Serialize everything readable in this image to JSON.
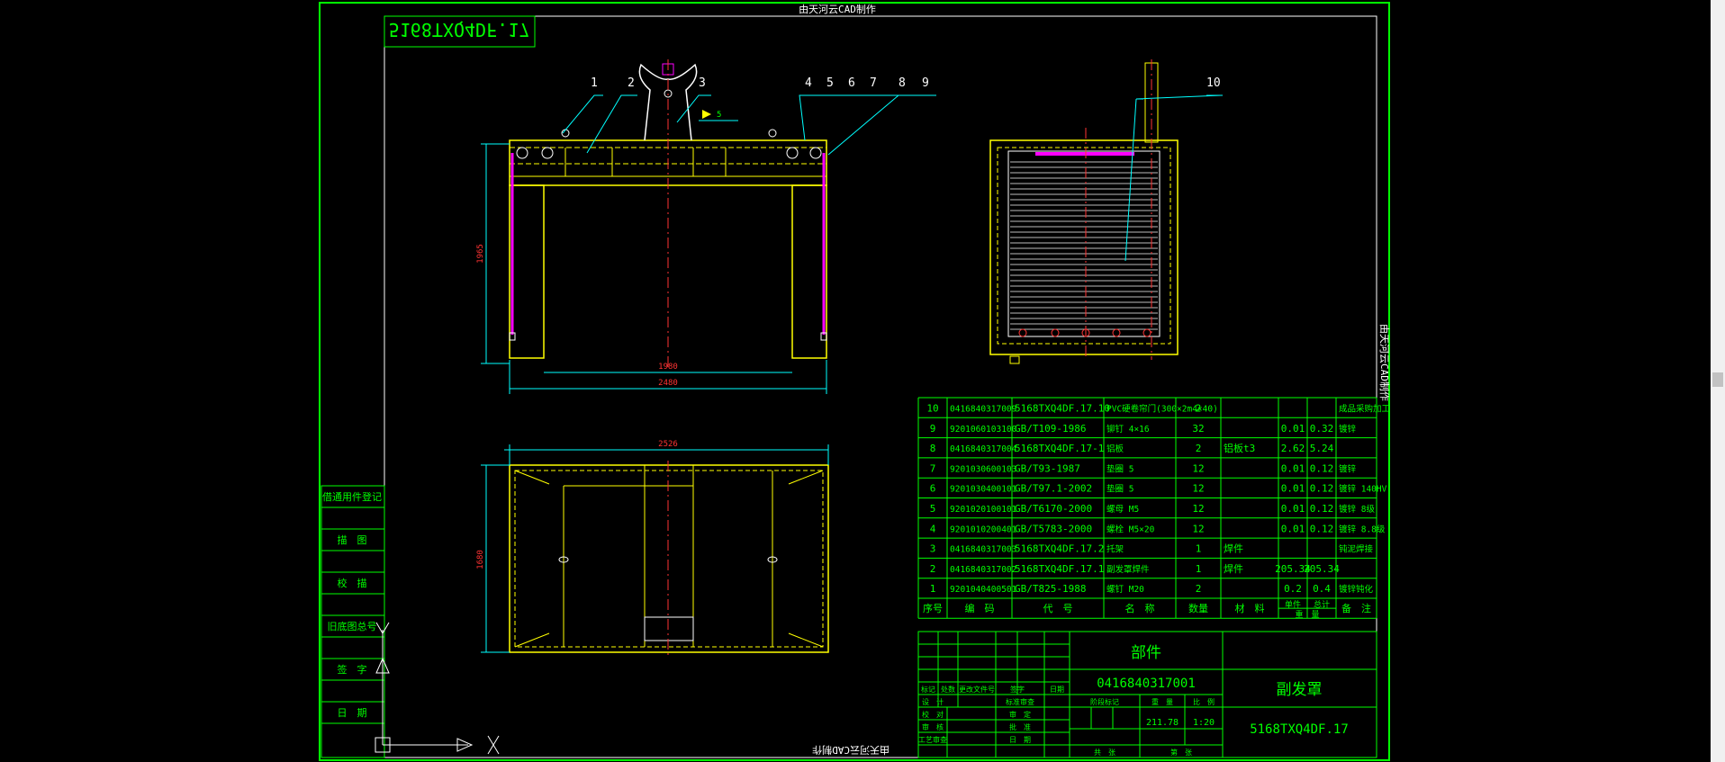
{
  "watermark_top": "由天河云CAD制作",
  "watermark_right": "由天河云CAD制作",
  "watermark_bottom": "由天河云CAD制作",
  "drawing_code_mirrored": "5168TXQ4DF.17",
  "callouts": [
    "1",
    "2",
    "3",
    "4",
    "5",
    "6",
    "7",
    "8",
    "9"
  ],
  "side_callout": "10",
  "dims": {
    "height_front": "1965",
    "inner_width": "1980",
    "outer_width": "2480",
    "plan_width": "2526",
    "plan_depth": "1680"
  },
  "left_stamp": [
    "借通用件登记",
    "描　图",
    "校　描",
    "旧底图总号",
    "签　字",
    "日　期"
  ],
  "bom_header": {
    "seq": "序号",
    "code": "编　码",
    "drawing": "代　号",
    "name": "名　称",
    "qty": "数量",
    "material": "材　料",
    "unit_weight": "单件",
    "total_weight": "总计",
    "weight": "重　量",
    "note": "备　注"
  },
  "bom_rows": [
    {
      "seq": "10",
      "code": "0416840317009",
      "drawing": "5168TXQ4DF.17.10",
      "name": "PVC硬卷帘门(300×2m4×40)",
      "qty": "2",
      "material": "",
      "uw": "",
      "tw": "",
      "note": "成品采购加工"
    },
    {
      "seq": "9",
      "code": "9201060103100",
      "drawing": "GB/T109-1986",
      "name": "铆钉 4×16",
      "qty": "32",
      "material": "",
      "uw": "0.01",
      "tw": "0.32",
      "note": "镀锌"
    },
    {
      "seq": "8",
      "code": "0416840317004",
      "drawing": "5168TXQ4DF.17-1",
      "name": "铝板",
      "qty": "2",
      "material": "铝板t3",
      "uw": "2.62",
      "tw": "5.24",
      "note": ""
    },
    {
      "seq": "7",
      "code": "9201030600103",
      "drawing": "GB/T93-1987",
      "name": "垫圈 5",
      "qty": "12",
      "material": "",
      "uw": "0.01",
      "tw": "0.12",
      "note": "镀锌"
    },
    {
      "seq": "6",
      "code": "9201030400101",
      "drawing": "GB/T97.1-2002",
      "name": "垫圈 5",
      "qty": "12",
      "material": "",
      "uw": "0.01",
      "tw": "0.12",
      "note": "镀锌 140HV"
    },
    {
      "seq": "5",
      "code": "9201020100101",
      "drawing": "GB/T6170-2000",
      "name": "螺母 M5",
      "qty": "12",
      "material": "",
      "uw": "0.01",
      "tw": "0.12",
      "note": "镀锌 8级"
    },
    {
      "seq": "4",
      "code": "9201010200401",
      "drawing": "GB/T5783-2000",
      "name": "螺栓 M5×20",
      "qty": "12",
      "material": "",
      "uw": "0.01",
      "tw": "0.12",
      "note": "镀锌 8.8级"
    },
    {
      "seq": "3",
      "code": "0416840317003",
      "drawing": "5168TXQ4DF.17.2",
      "name": "托架",
      "qty": "1",
      "material": "焊件",
      "uw": "",
      "tw": "",
      "note": "钝泥焊接"
    },
    {
      "seq": "2",
      "code": "0416840317002",
      "drawing": "5168TXQ4DF.17.1",
      "name": "副发罩焊件",
      "qty": "1",
      "material": "焊件",
      "uw": "205.34",
      "tw": "205.34",
      "note": ""
    },
    {
      "seq": "1",
      "code": "9201040400501",
      "drawing": "GB/T825-1988",
      "name": "螺钉 M20",
      "qty": "2",
      "material": "",
      "uw": "0.2",
      "tw": "0.4",
      "note": "镀锌钝化"
    }
  ],
  "title_block": {
    "category": "部件",
    "part_code": "0416840317001",
    "part_name": "副发罩",
    "drawing_no": "5168TXQ4DF.17",
    "weight": "211.78",
    "scale": "1:20",
    "labels": {
      "stage": "阶段标记",
      "weight_label": "重　量",
      "scale_label": "比　例",
      "sheets": "共　张",
      "sheet": "第　张"
    },
    "rev_labels": [
      "标记",
      "处数",
      "更改文件号",
      "签字",
      "日期"
    ],
    "sign_labels": [
      "设　计",
      "校　对",
      "审　核",
      "工艺审查"
    ],
    "sign_labels2": [
      "标准审查",
      "审　定",
      "批　准",
      "日　期"
    ]
  }
}
